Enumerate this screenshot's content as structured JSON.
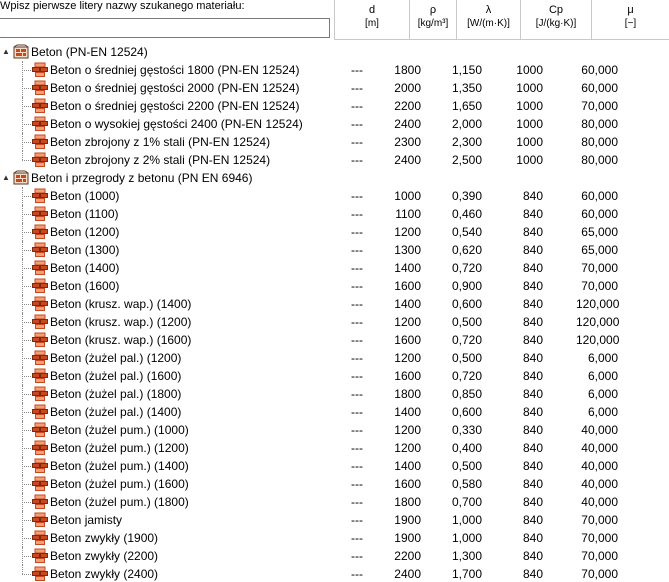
{
  "search": {
    "prompt": "Wpisz pierwsze litery nazwy szukanego materiału:",
    "value": ""
  },
  "columns": [
    {
      "name": "d",
      "unit": "[m]"
    },
    {
      "name": "ρ",
      "unit": "[kg/m³]"
    },
    {
      "name": "λ",
      "unit": "[W/(m·K)]"
    },
    {
      "name": "Cp",
      "unit": "[J/(kg·K)]"
    },
    {
      "name": "μ",
      "unit": "[−]"
    }
  ],
  "groups": [
    {
      "name": "Beton (PN-EN 12524)",
      "expander": "▲",
      "items": [
        {
          "name": "Beton o średniej gęstości 1800 (PN-EN 12524)",
          "d": "---",
          "rho": "1800",
          "lambda": "1,150",
          "cp": "1000",
          "mu": "60,000"
        },
        {
          "name": "Beton o średniej gęstości 2000 (PN-EN 12524)",
          "d": "---",
          "rho": "2000",
          "lambda": "1,350",
          "cp": "1000",
          "mu": "60,000"
        },
        {
          "name": "Beton o średniej gęstości 2200 (PN-EN 12524)",
          "d": "---",
          "rho": "2200",
          "lambda": "1,650",
          "cp": "1000",
          "mu": "70,000"
        },
        {
          "name": "Beton o wysokiej gęstości 2400 (PN-EN 12524)",
          "d": "---",
          "rho": "2400",
          "lambda": "2,000",
          "cp": "1000",
          "mu": "80,000"
        },
        {
          "name": "Beton zbrojony z 1% stali  (PN-EN 12524)",
          "d": "---",
          "rho": "2300",
          "lambda": "2,300",
          "cp": "1000",
          "mu": "80,000"
        },
        {
          "name": "Beton zbrojony z 2% stali  (PN-EN 12524)",
          "d": "---",
          "rho": "2400",
          "lambda": "2,500",
          "cp": "1000",
          "mu": "80,000"
        }
      ]
    },
    {
      "name": "Beton i przegrody z betonu (PN EN 6946)",
      "expander": "▲",
      "items": [
        {
          "name": "Beton (1000)",
          "d": "---",
          "rho": "1000",
          "lambda": "0,390",
          "cp": "840",
          "mu": "60,000"
        },
        {
          "name": "Beton (1100)",
          "d": "---",
          "rho": "1100",
          "lambda": "0,460",
          "cp": "840",
          "mu": "60,000"
        },
        {
          "name": "Beton (1200)",
          "d": "---",
          "rho": "1200",
          "lambda": "0,540",
          "cp": "840",
          "mu": "65,000"
        },
        {
          "name": "Beton (1300)",
          "d": "---",
          "rho": "1300",
          "lambda": "0,620",
          "cp": "840",
          "mu": "65,000"
        },
        {
          "name": "Beton (1400)",
          "d": "---",
          "rho": "1400",
          "lambda": "0,720",
          "cp": "840",
          "mu": "70,000"
        },
        {
          "name": "Beton (1600)",
          "d": "---",
          "rho": "1600",
          "lambda": "0,900",
          "cp": "840",
          "mu": "70,000"
        },
        {
          "name": "Beton (krusz. wap.) (1400)",
          "d": "---",
          "rho": "1400",
          "lambda": "0,600",
          "cp": "840",
          "mu": "120,000"
        },
        {
          "name": "Beton (krusz. wap.) (1200)",
          "d": "---",
          "rho": "1200",
          "lambda": "0,500",
          "cp": "840",
          "mu": "120,000"
        },
        {
          "name": "Beton (krusz. wap.) (1600)",
          "d": "---",
          "rho": "1600",
          "lambda": "0,720",
          "cp": "840",
          "mu": "120,000"
        },
        {
          "name": "Beton (żużel pal.)  (1200)",
          "d": "---",
          "rho": "1200",
          "lambda": "0,500",
          "cp": "840",
          "mu": "6,000"
        },
        {
          "name": "Beton (żużel pal.)  (1600)",
          "d": "---",
          "rho": "1600",
          "lambda": "0,720",
          "cp": "840",
          "mu": "6,000"
        },
        {
          "name": "Beton (żużel pal.)  (1800)",
          "d": "---",
          "rho": "1800",
          "lambda": "0,850",
          "cp": "840",
          "mu": "6,000"
        },
        {
          "name": "Beton (żużel pal.) (1400)",
          "d": "---",
          "rho": "1400",
          "lambda": "0,600",
          "cp": "840",
          "mu": "6,000"
        },
        {
          "name": "Beton (żużel pum.) (1000)",
          "d": "---",
          "rho": "1200",
          "lambda": "0,330",
          "cp": "840",
          "mu": "40,000"
        },
        {
          "name": "Beton (żużel pum.) (1200)",
          "d": "---",
          "rho": "1200",
          "lambda": "0,400",
          "cp": "840",
          "mu": "40,000"
        },
        {
          "name": "Beton (żużel pum.) (1400)",
          "d": "---",
          "rho": "1400",
          "lambda": "0,500",
          "cp": "840",
          "mu": "40,000"
        },
        {
          "name": "Beton (żużel pum.) (1600)",
          "d": "---",
          "rho": "1600",
          "lambda": "0,580",
          "cp": "840",
          "mu": "40,000"
        },
        {
          "name": "Beton (żużel pum.) (1800)",
          "d": "---",
          "rho": "1800",
          "lambda": "0,700",
          "cp": "840",
          "mu": "40,000"
        },
        {
          "name": "Beton jamisty",
          "d": "---",
          "rho": "1900",
          "lambda": "1,000",
          "cp": "840",
          "mu": "70,000"
        },
        {
          "name": "Beton zwykły (1900)",
          "d": "---",
          "rho": "1900",
          "lambda": "1,000",
          "cp": "840",
          "mu": "70,000"
        },
        {
          "name": "Beton zwykły (2200)",
          "d": "---",
          "rho": "2200",
          "lambda": "1,300",
          "cp": "840",
          "mu": "70,000"
        },
        {
          "name": "Beton zwykły (2400)",
          "d": "---",
          "rho": "2400",
          "lambda": "1,700",
          "cp": "840",
          "mu": "70,000"
        }
      ]
    }
  ],
  "icons": {
    "group": "material-group-icon",
    "item": "material-item-icon"
  },
  "colors": {
    "material_icon": "#c8471f",
    "material_icon_light": "#f0a078",
    "group_icon": "#5a3a28",
    "grid": "#c9c9c9",
    "tree_lines": "#8a8a8a"
  }
}
